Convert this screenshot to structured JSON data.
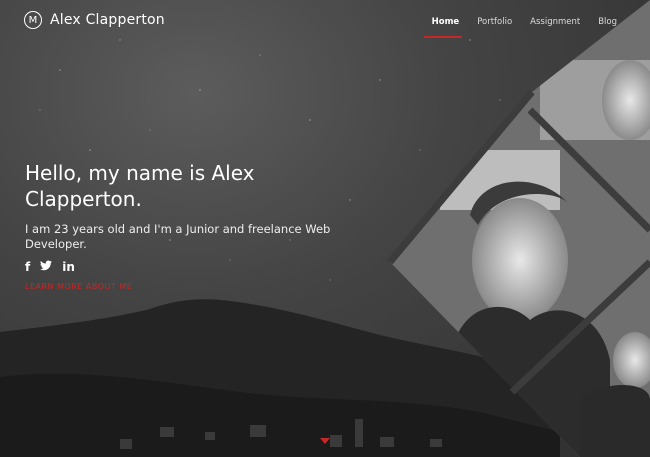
{
  "header": {
    "logo_mark": "M",
    "site_name": "Alex Clapperton"
  },
  "nav": {
    "items": [
      {
        "label": "Home",
        "active": true
      },
      {
        "label": "Portfolio",
        "active": false
      },
      {
        "label": "Assignment",
        "active": false
      },
      {
        "label": "Blog",
        "active": false
      }
    ]
  },
  "hero": {
    "title": "Hello, my name is Alex Clapperton.",
    "subtitle": "I am 23 years old and I'm a Junior and freelance Web Developer.",
    "social": [
      "f",
      "t",
      "in"
    ],
    "learn_more": "LEARN MORE ABOUT ME"
  },
  "colors": {
    "accent": "#c62828",
    "background": "#444444"
  }
}
